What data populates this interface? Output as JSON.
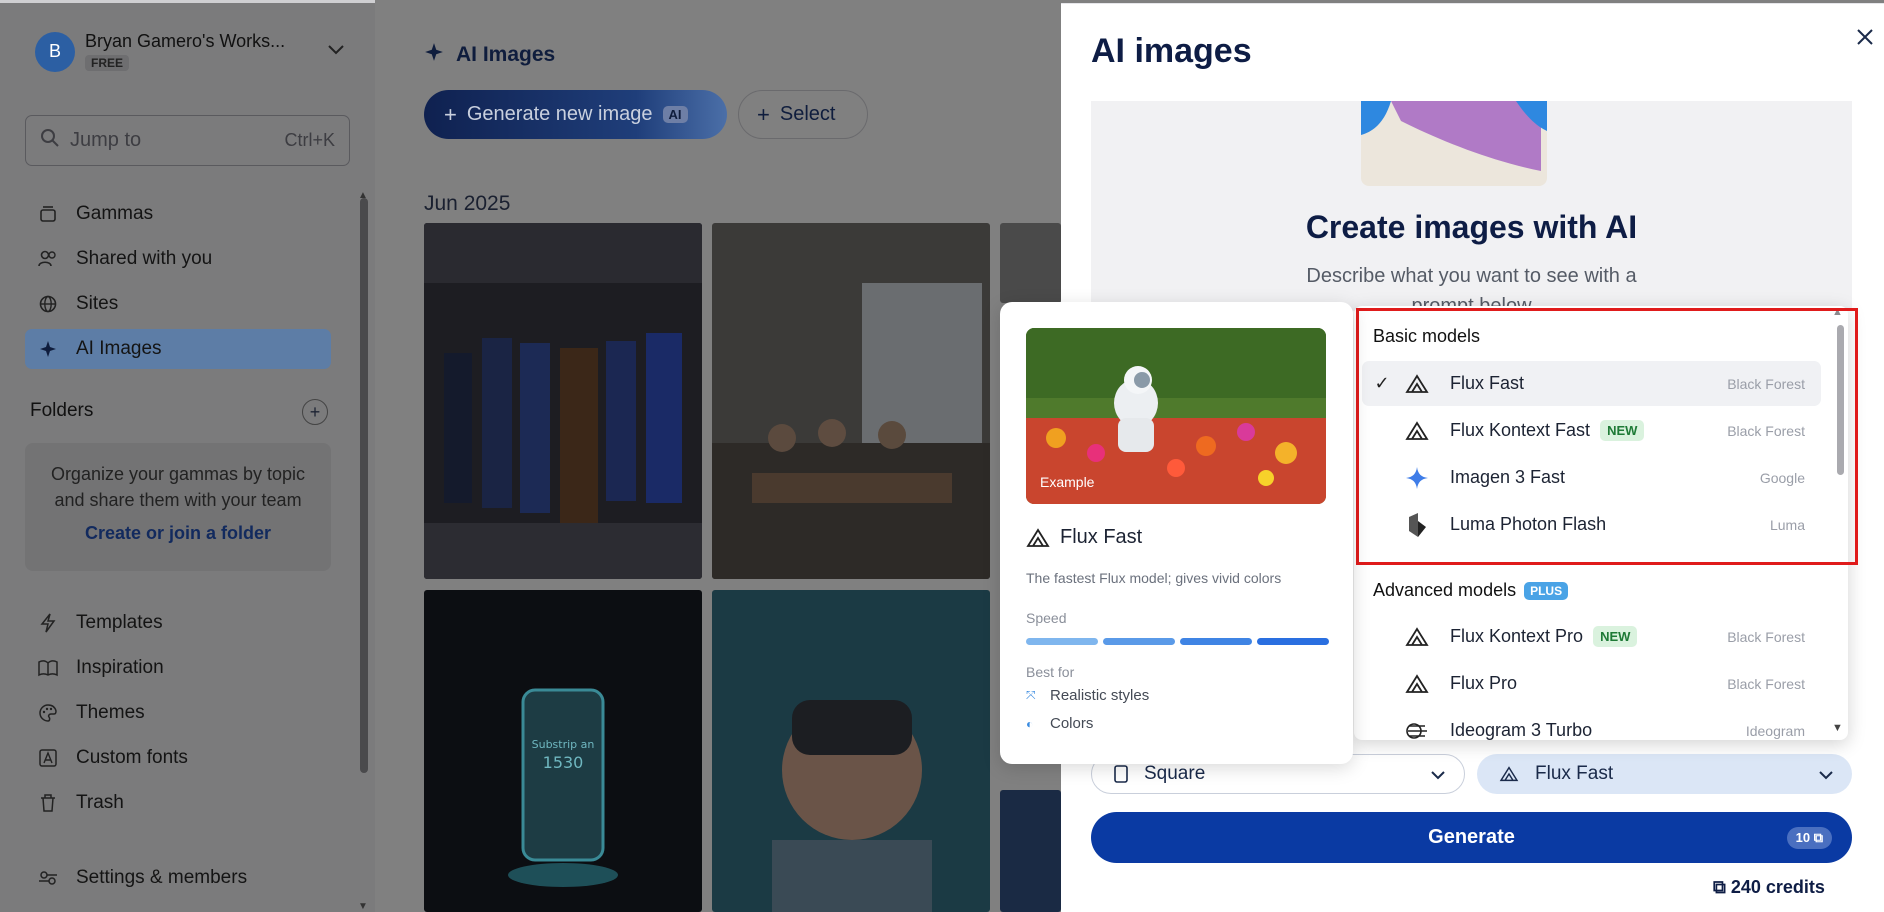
{
  "sidebar": {
    "workspace_name": "Bryan Gamero's Works...",
    "workspace_plan": "FREE",
    "avatar_letter": "B",
    "search_placeholder": "Jump to",
    "search_shortcut": "Ctrl+K",
    "nav_top": [
      {
        "label": "Gammas",
        "icon": "stack-icon"
      },
      {
        "label": "Shared with you",
        "icon": "users-icon"
      },
      {
        "label": "Sites",
        "icon": "globe-icon"
      },
      {
        "label": "AI Images",
        "icon": "sparkle-icon",
        "active": true
      }
    ],
    "folders_heading": "Folders",
    "folders_empty_text": "Organize your gammas by topic and share them with your team",
    "folders_link": "Create or join a folder",
    "nav_bottom": [
      {
        "label": "Templates",
        "icon": "bolt-icon"
      },
      {
        "label": "Inspiration",
        "icon": "book-icon"
      },
      {
        "label": "Themes",
        "icon": "palette-icon"
      },
      {
        "label": "Custom fonts",
        "icon": "font-icon"
      },
      {
        "label": "Trash",
        "icon": "trash-icon"
      },
      {
        "label": "Settings & members",
        "icon": "settings-icon"
      }
    ]
  },
  "main": {
    "title": "AI Images",
    "generate_button": "Generate new image",
    "generate_badge": "AI",
    "select_button": "Select",
    "month_label": "Jun 2025"
  },
  "panel": {
    "title": "AI images",
    "hero_title": "Create images with AI",
    "hero_subtitle_line1": "Describe what you want to see with a",
    "hero_subtitle_line2": "prompt below",
    "aspect_value": "Square",
    "model_value": "Flux Fast",
    "generate_label": "Generate",
    "generate_cost": "10",
    "credits_label": "240 credits"
  },
  "dropdown": {
    "basic_heading": "Basic models",
    "advanced_heading": "Advanced models",
    "advanced_badge": "PLUS",
    "basic_models": [
      {
        "name": "Flux Fast",
        "provider": "Black Forest",
        "selected": true,
        "badge": ""
      },
      {
        "name": "Flux Kontext Fast",
        "provider": "Black Forest",
        "selected": false,
        "badge": "NEW"
      },
      {
        "name": "Imagen 3 Fast",
        "provider": "Google",
        "selected": false,
        "badge": ""
      },
      {
        "name": "Luma Photon Flash",
        "provider": "Luma",
        "selected": false,
        "badge": ""
      }
    ],
    "advanced_models": [
      {
        "name": "Flux Kontext Pro",
        "provider": "Black Forest",
        "badge": "NEW"
      },
      {
        "name": "Flux Pro",
        "provider": "Black Forest",
        "badge": ""
      },
      {
        "name": "Ideogram 3 Turbo",
        "provider": "Ideogram",
        "badge": ""
      }
    ]
  },
  "preview": {
    "image_tag": "Example",
    "model_name": "Flux Fast",
    "description": "The fastest Flux model; gives vivid colors",
    "speed_label": "Speed",
    "speed_level": 1.0,
    "best_for_label": "Best for",
    "best_for": [
      "Realistic styles",
      "Colors"
    ]
  },
  "colors": {
    "accent": "#0a3aa3",
    "selection_highlight": "#e01b1b",
    "new_badge": "#daf2de",
    "plus_badge": "#4aa3e6"
  }
}
